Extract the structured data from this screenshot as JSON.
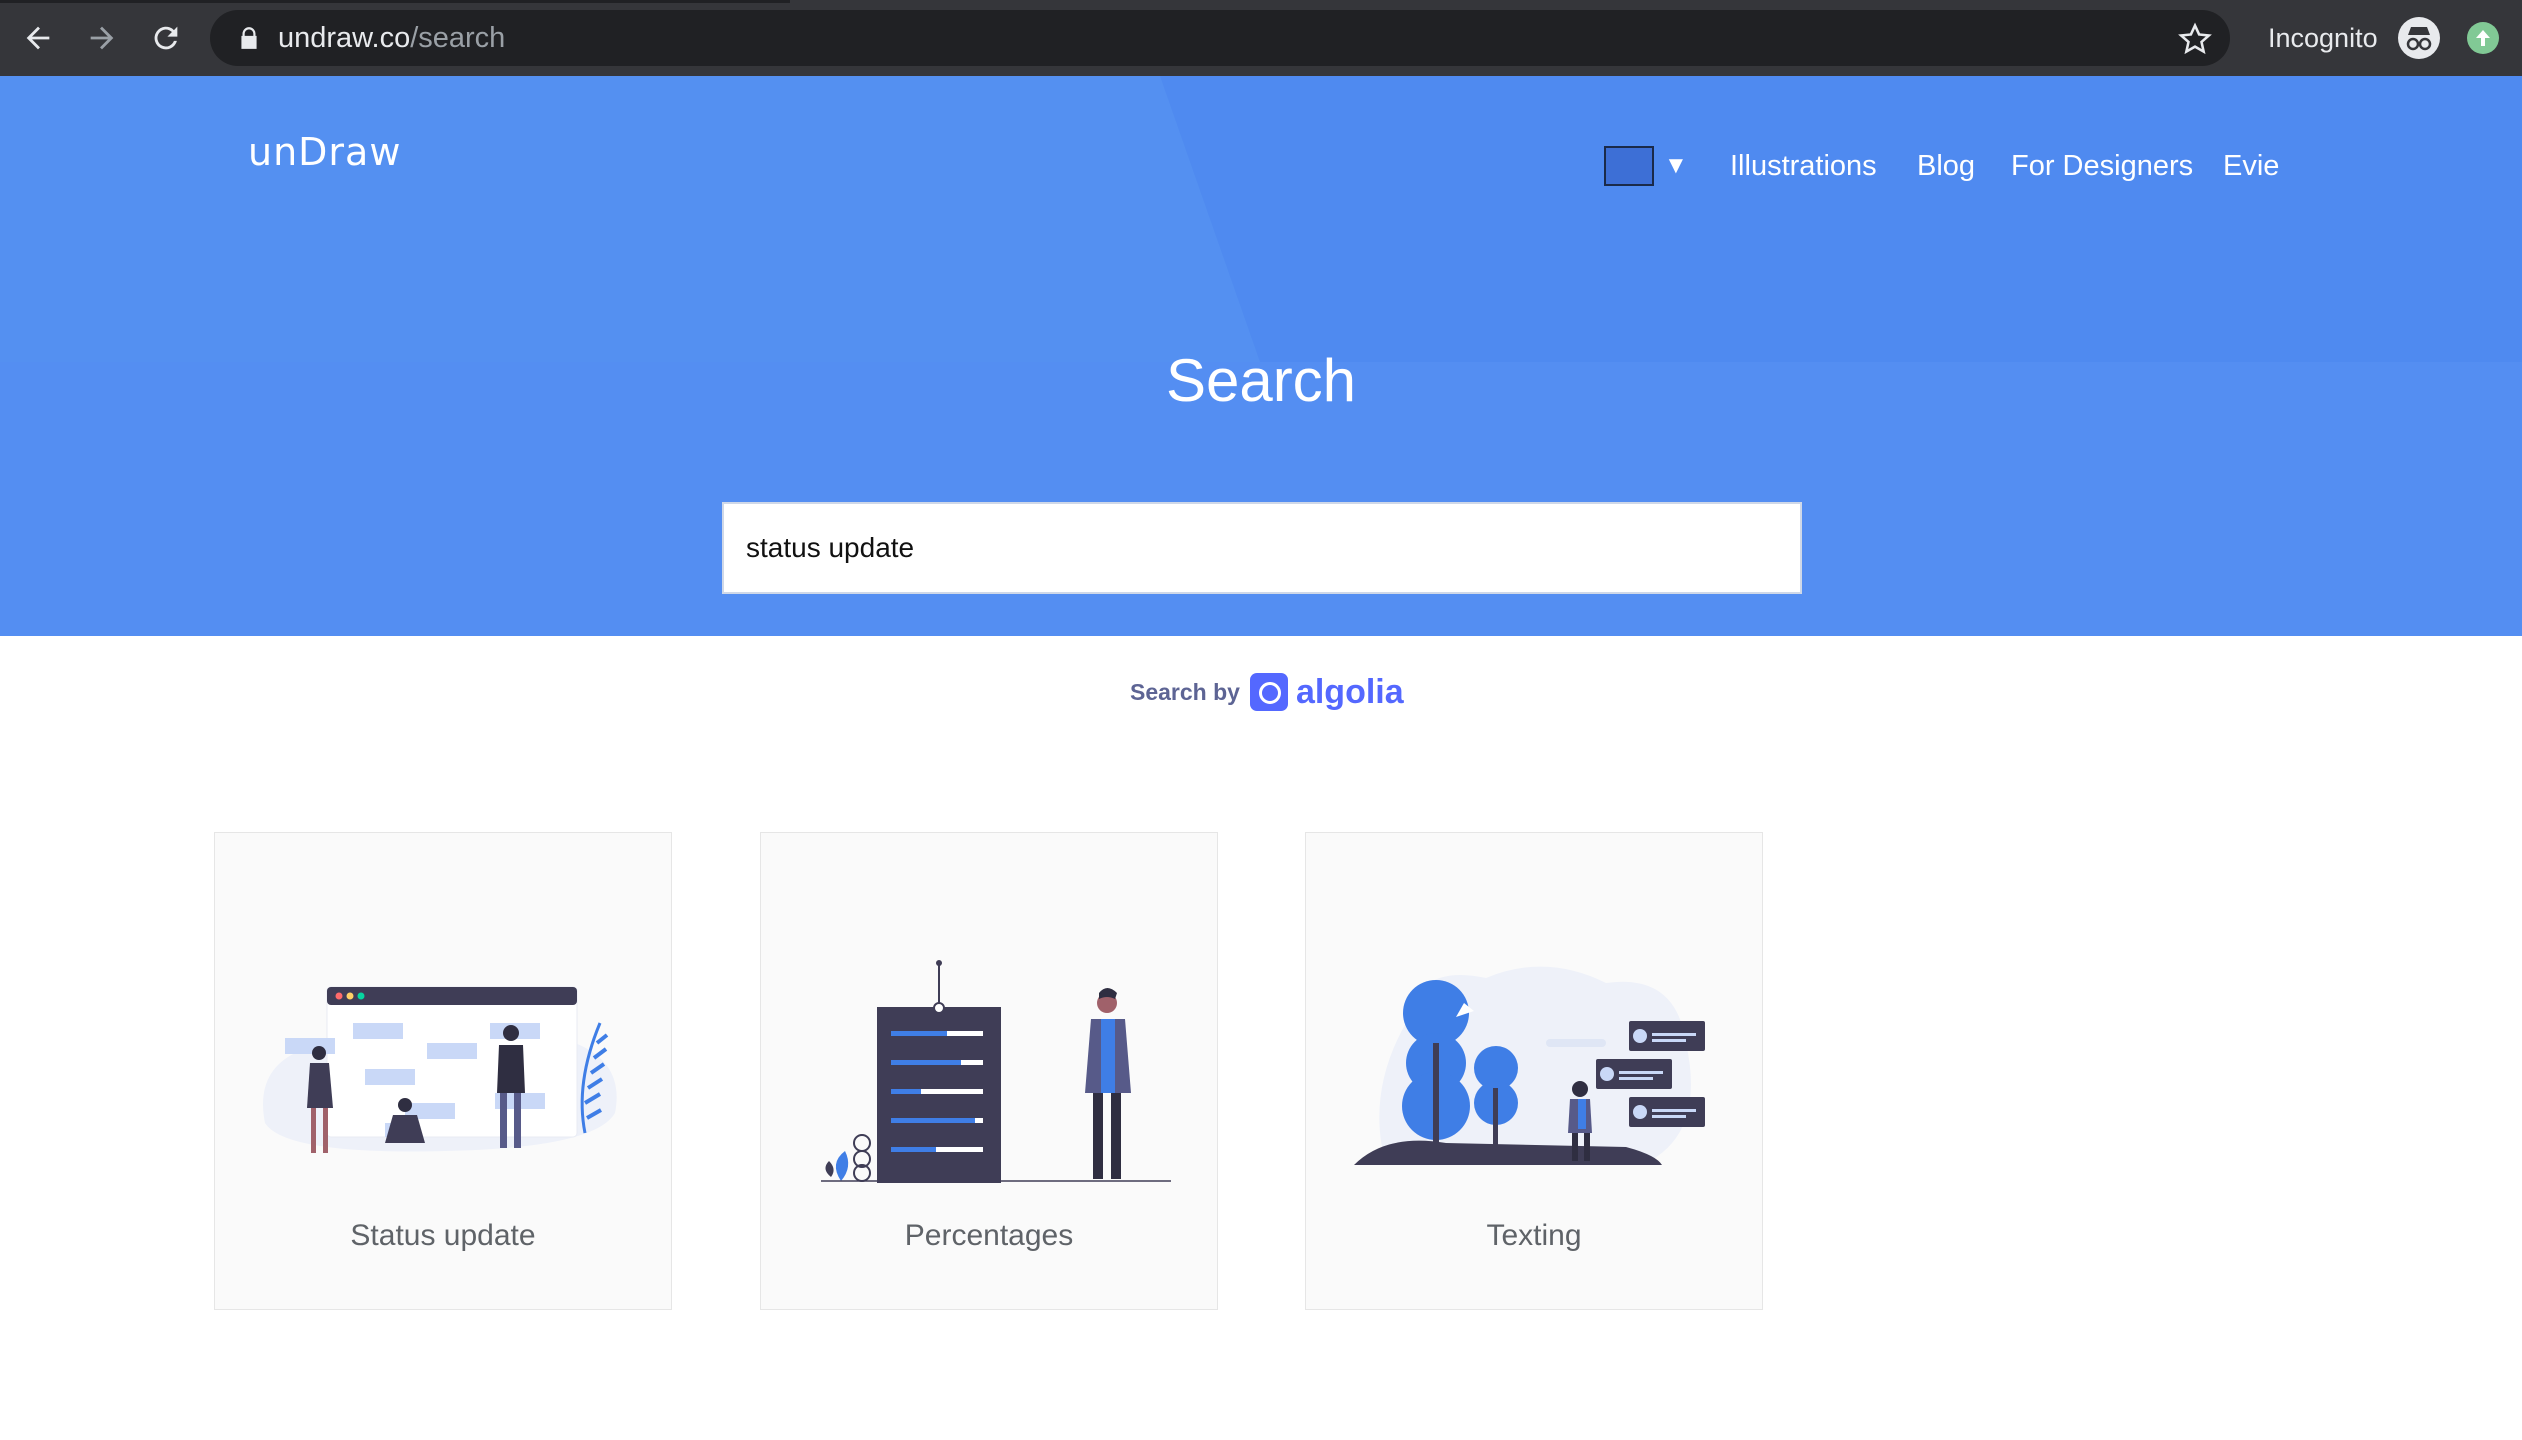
{
  "browser": {
    "url_host": "undraw.co",
    "url_path": "/search",
    "incognito_label": "Incognito"
  },
  "site": {
    "logo": "unDraw",
    "accent_color": "#3d6fd6",
    "nav": [
      "Illustrations",
      "Blog",
      "For Designers",
      "Evie"
    ]
  },
  "hero": {
    "title": "Search",
    "search_value": "status update"
  },
  "algolia": {
    "search_by": "Search by",
    "brand": "algolia"
  },
  "results": [
    {
      "title": "Status update",
      "icon": "status-update-illustration"
    },
    {
      "title": "Percentages",
      "icon": "percentages-illustration"
    },
    {
      "title": "Texting",
      "icon": "texting-illustration"
    }
  ],
  "colors": {
    "hero_bg": "#508cef",
    "chrome_bg": "#35363a",
    "illustration_blue": "#3f7ee6",
    "illustration_dark": "#3f3d56"
  }
}
